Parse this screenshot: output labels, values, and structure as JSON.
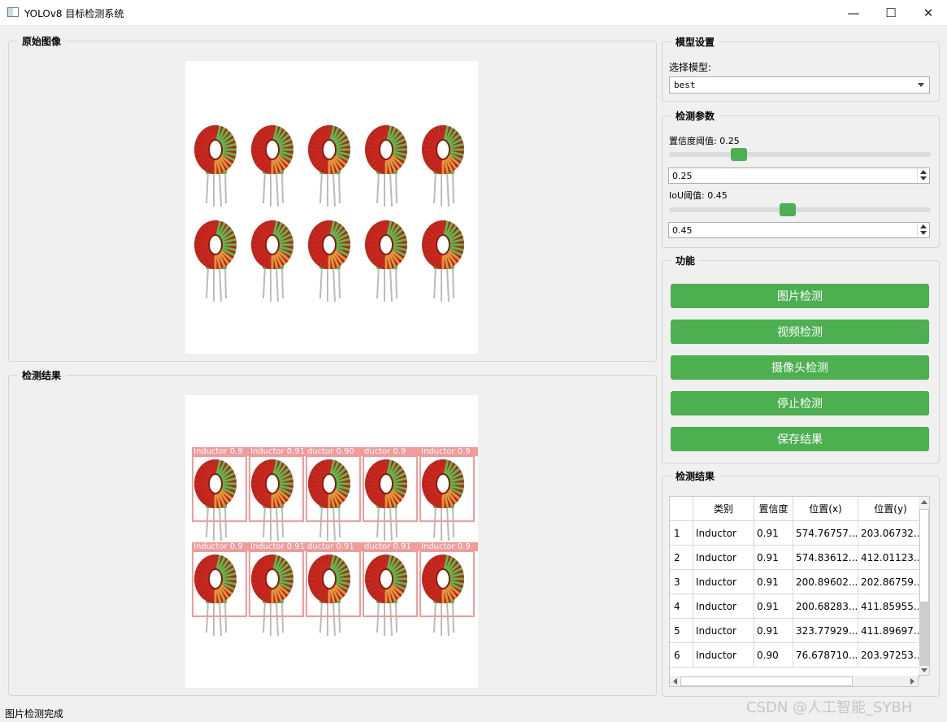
{
  "window": {
    "title": "YOLOv8 目标检测系统",
    "controls": [
      "—",
      "☐",
      "✕"
    ]
  },
  "original_panel": {
    "title": "原始图像"
  },
  "result_panel": {
    "title": "检测结果"
  },
  "model_settings": {
    "title": "模型设置",
    "select_label": "选择模型:",
    "selected_model": "best"
  },
  "detect_params": {
    "title": "检测参数",
    "conf_label": "置信度阈值: 0.25",
    "conf_value": "0.25",
    "conf_fraction": 0.25,
    "iou_label": "IoU阈值: 0.45",
    "iou_value": "0.45",
    "iou_fraction": 0.45
  },
  "functions": {
    "title": "功能",
    "buttons": [
      "图片检测",
      "视频检测",
      "摄像头检测",
      "停止检测",
      "保存结果"
    ]
  },
  "results_table": {
    "title": "检测结果",
    "headers": [
      "类别",
      "置信度",
      "位置(x)",
      "位置(y)"
    ],
    "rows": [
      [
        "1",
        "Inductor",
        "0.91",
        "574.76757...",
        "203.06732..."
      ],
      [
        "2",
        "Inductor",
        "0.91",
        "574.83612...",
        "412.01123..."
      ],
      [
        "3",
        "Inductor",
        "0.91",
        "200.89602...",
        "202.86759..."
      ],
      [
        "4",
        "Inductor",
        "0.91",
        "200.68283...",
        "411.85955..."
      ],
      [
        "5",
        "Inductor",
        "0.91",
        "323.77929...",
        "411.89697..."
      ],
      [
        "6",
        "Inductor",
        "0.90",
        "76.678710...",
        "203.97253..."
      ]
    ]
  },
  "detection_labels": [
    "Inductor 0.9",
    "Inductor 0.91",
    "ductor 0.90",
    "ductor 0.9",
    "Inductor 0.9",
    "Inductor 0.9",
    "Inductor 0.91",
    "ductor 0.91",
    "ductor 0.91",
    "Inductor 0.9"
  ],
  "status_bar": {
    "text": "图片检测完成"
  },
  "watermark": {
    "text": "CSDN @人工智能_SYBH"
  },
  "colors": {
    "accent": "#4caf50",
    "bbox": "#f19b9b"
  }
}
